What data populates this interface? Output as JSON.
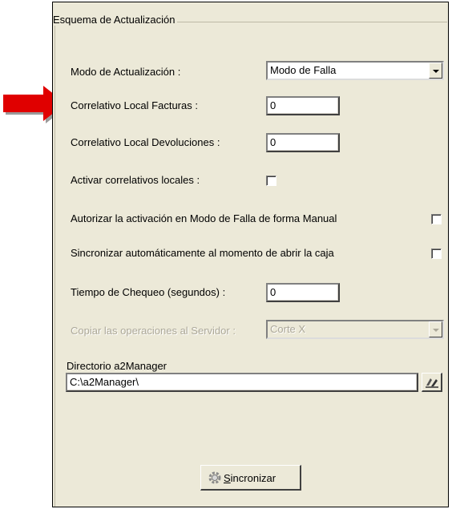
{
  "group": {
    "title": "Esquema de Actualización"
  },
  "modo": {
    "label": "Modo de Actualización :",
    "value": "Modo de Falla"
  },
  "facturas": {
    "label": "Correlativo Local Facturas :",
    "value": "0"
  },
  "devoluciones": {
    "label": "Correlativo Local Devoluciones :",
    "value": "0"
  },
  "activar": {
    "label": "Activar correlativos locales :"
  },
  "autorizar": {
    "label": "Autorizar la activación en Modo de Falla de forma Manual"
  },
  "sincronizar_auto": {
    "label": "Sincronizar automáticamente al momento de abrir la caja"
  },
  "tiempo": {
    "label": "Tiempo de Chequeo (segundos) :",
    "value": "0"
  },
  "copiar": {
    "label": "Copiar las operaciones al Servidor :",
    "value": "Corte X"
  },
  "directorio": {
    "label": "Directorio a2Manager",
    "value": "C:\\a2Manager\\"
  },
  "sync_button": {
    "mnemonic": "S",
    "rest": "incronizar"
  },
  "icons": {
    "browse": "folder-browse-icon",
    "sync": "gear-icon",
    "annotation": "red-arrow-icon"
  },
  "colors": {
    "panel": "#ece9d8",
    "arrow": "#e00000"
  }
}
